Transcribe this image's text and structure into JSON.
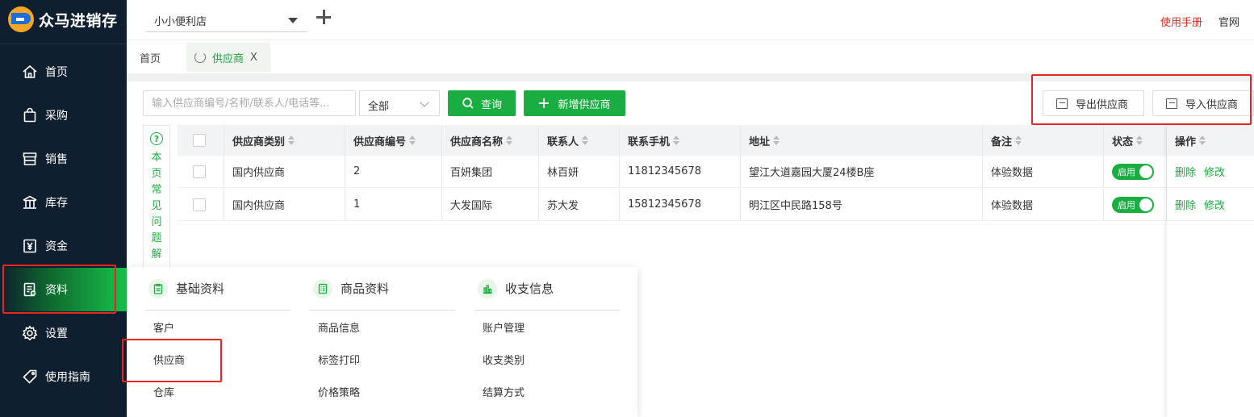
{
  "app": {
    "logo_text": "众马进销存"
  },
  "sidebar": {
    "items": [
      {
        "label": "首页",
        "icon": "home-icon"
      },
      {
        "label": "采购",
        "icon": "shopping-bag-icon"
      },
      {
        "label": "销售",
        "icon": "store-icon"
      },
      {
        "label": "库存",
        "icon": "warehouse-icon"
      },
      {
        "label": "资金",
        "icon": "yen-icon"
      },
      {
        "label": "资料",
        "icon": "document-icon",
        "active": true
      },
      {
        "label": "设置",
        "icon": "gear-icon"
      },
      {
        "label": "使用指南",
        "icon": "tag-icon"
      }
    ]
  },
  "topbar": {
    "store": "小小便利店",
    "manual_link": "使用手册",
    "site_link": "官网"
  },
  "tabs": [
    {
      "label": "首页"
    },
    {
      "label": "供应商",
      "active": true,
      "close": "X"
    }
  ],
  "toolbar": {
    "search_placeholder": "输入供应商编号/名称/联系人/电话等...",
    "filter_value": "全部",
    "query_label": "查询",
    "add_label": "新增供应商",
    "export_label": "导出供应商",
    "import_label": "导入供应商"
  },
  "faq": {
    "text": "本页常见问题解"
  },
  "table": {
    "columns": [
      "供应商类别",
      "供应商编号",
      "供应商名称",
      "联系人",
      "联系手机",
      "地址",
      "备注",
      "状态",
      "操作"
    ],
    "rows": [
      {
        "category": "国内供应商",
        "code": "2",
        "name": "百妍集团",
        "contact": "林百妍",
        "phone": "11812345678",
        "address": "望江大道嘉园大厦24楼B座",
        "note": "体验数据",
        "status": "启用",
        "delete": "删除",
        "edit": "修改"
      },
      {
        "category": "国内供应商",
        "code": "1",
        "name": "大发国际",
        "contact": "苏大发",
        "phone": "15812345678",
        "address": "明江区中民路158号",
        "note": "体验数据",
        "status": "启用",
        "delete": "删除",
        "edit": "修改"
      }
    ]
  },
  "dropdown": {
    "columns": [
      {
        "title": "基础资料",
        "icon": "clipboard-icon",
        "items": [
          "客户",
          "供应商",
          "仓库"
        ]
      },
      {
        "title": "商品资料",
        "icon": "list-icon",
        "items": [
          "商品信息",
          "标签打印",
          "价格策略"
        ]
      },
      {
        "title": "收支信息",
        "icon": "bar-chart-icon",
        "items": [
          "账户管理",
          "收支类别",
          "结算方式"
        ]
      }
    ]
  },
  "colors": {
    "accent": "#1aad41",
    "sidebar_bg": "#0f1f2f",
    "highlight_red": "#e8261f",
    "manual_red": "#e02a1e"
  }
}
